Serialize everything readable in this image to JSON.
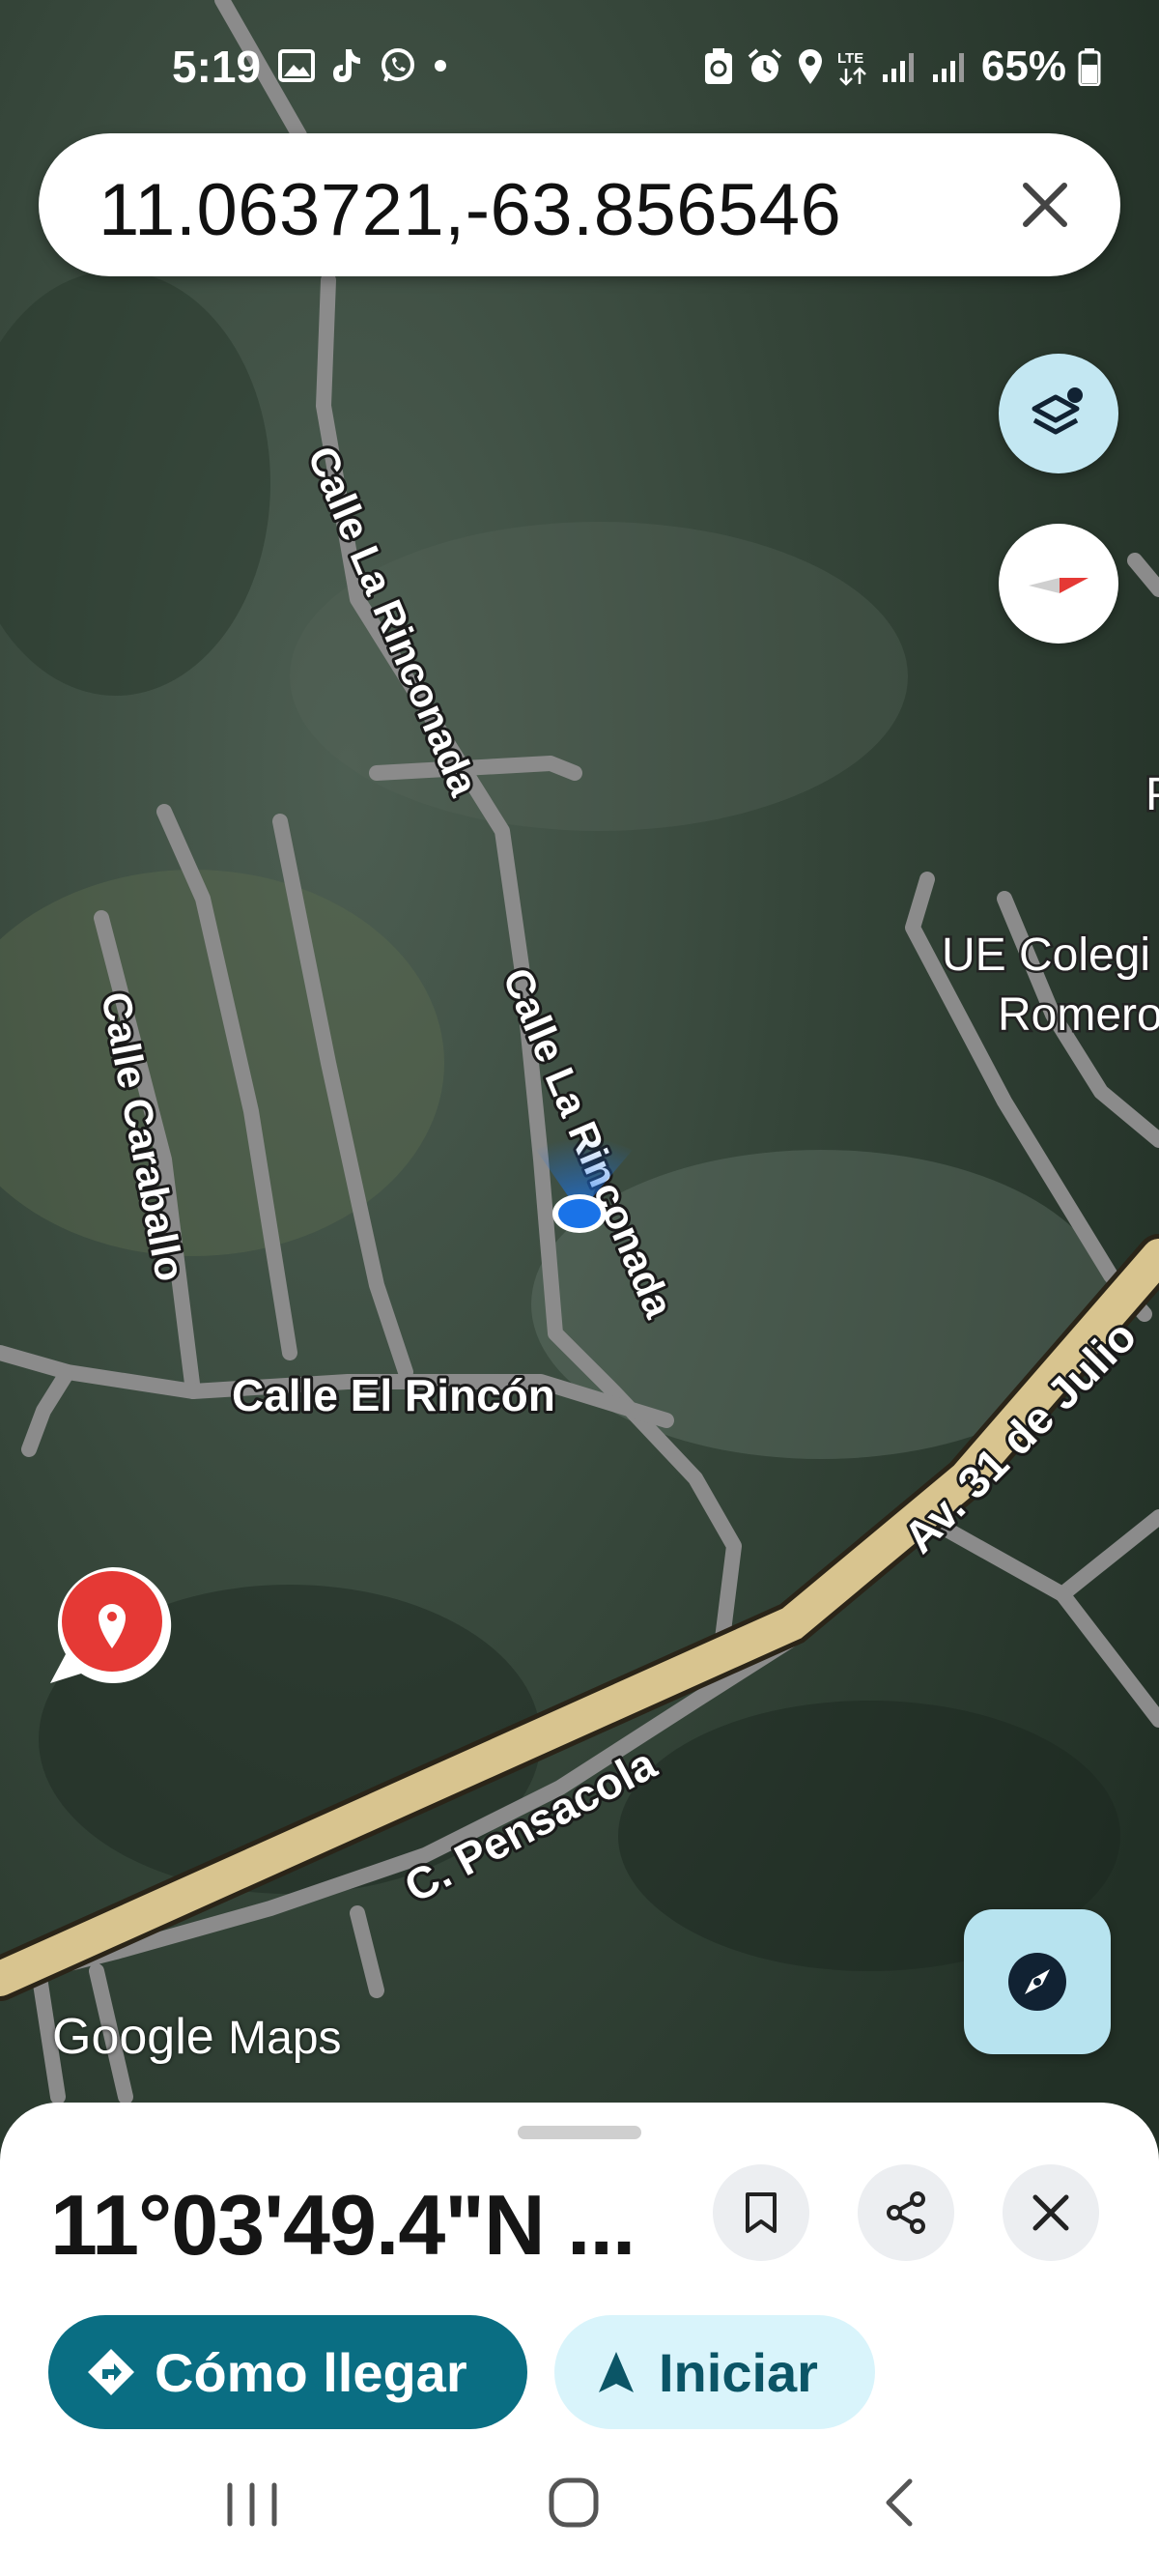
{
  "status_bar": {
    "time": "5:19",
    "battery": "65%",
    "network": "LTE"
  },
  "search": {
    "query": "11.063721,-63.856546"
  },
  "map": {
    "labels": {
      "calle_la_rinconada_1": "Calle La Rinconada",
      "calle_la_rinconada_2": "Calle La Rinconada",
      "calle_caraballo": "Calle Caraballo",
      "calle_el_rincon": "Calle El Rincón",
      "av_31_de_julio": "Av. 31 de Julio",
      "c_pensacola": "C. Pensacola",
      "ue_colegio_1": "UE Colegi",
      "ue_colegio_2": "Romero",
      "edge_p": "P"
    },
    "logo_google": "Google",
    "logo_maps": "Maps"
  },
  "sheet": {
    "coordinates": "11°03'49.4\"N ...",
    "directions_label": "Cómo llegar",
    "start_label": "Iniciar"
  },
  "colors": {
    "primary_button": "#0a6e83",
    "secondary_button": "#d9f4fb",
    "pin_red": "#e53935",
    "location_blue": "#1a73e8",
    "main_road": "#d8c48f"
  },
  "icons": [
    "search-clear-icon",
    "layers-icon",
    "compass-icon",
    "map-pin-icon",
    "recenter-icon",
    "bookmark-icon",
    "share-icon",
    "close-icon",
    "directions-icon",
    "navigate-arrow-icon"
  ]
}
